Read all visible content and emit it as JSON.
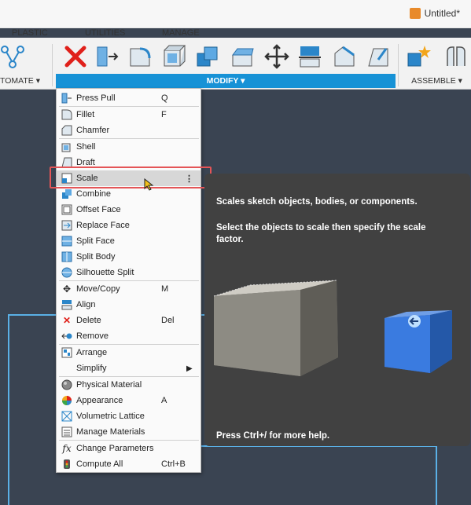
{
  "document": {
    "title": "Untitled*"
  },
  "tabs": [
    "PLASTIC",
    "UTILITIES",
    "MANAGE"
  ],
  "groups": {
    "automate": "TOMATE ▾",
    "modify": "MODIFY ▾",
    "assemble": "ASSEMBLE ▾"
  },
  "menu": {
    "items": [
      {
        "label": "Press Pull",
        "shortcut": "Q",
        "icon": "press-pull-icon"
      },
      {
        "label": "Fillet",
        "shortcut": "F",
        "icon": "fillet-icon"
      },
      {
        "label": "Chamfer",
        "shortcut": "",
        "icon": "chamfer-icon"
      },
      {
        "label": "Shell",
        "shortcut": "",
        "icon": "shell-icon"
      },
      {
        "label": "Draft",
        "shortcut": "",
        "icon": "draft-icon"
      },
      {
        "label": "Scale",
        "shortcut": "",
        "icon": "scale-icon"
      },
      {
        "label": "Combine",
        "shortcut": "",
        "icon": "combine-icon"
      },
      {
        "label": "Offset Face",
        "shortcut": "",
        "icon": "offset-face-icon"
      },
      {
        "label": "Replace Face",
        "shortcut": "",
        "icon": "replace-face-icon"
      },
      {
        "label": "Split Face",
        "shortcut": "",
        "icon": "split-face-icon"
      },
      {
        "label": "Split Body",
        "shortcut": "",
        "icon": "split-body-icon"
      },
      {
        "label": "Silhouette Split",
        "shortcut": "",
        "icon": "silhouette-split-icon"
      },
      {
        "label": "Move/Copy",
        "shortcut": "M",
        "icon": "move-icon"
      },
      {
        "label": "Align",
        "shortcut": "",
        "icon": "align-icon"
      },
      {
        "label": "Delete",
        "shortcut": "Del",
        "icon": "delete-icon"
      },
      {
        "label": "Remove",
        "shortcut": "",
        "icon": "remove-icon"
      },
      {
        "label": "Arrange",
        "shortcut": "",
        "icon": "arrange-icon"
      },
      {
        "label": "Simplify",
        "shortcut": "",
        "icon": "chevron-right-icon"
      },
      {
        "label": "Physical Material",
        "shortcut": "",
        "icon": "physical-material-icon"
      },
      {
        "label": "Appearance",
        "shortcut": "A",
        "icon": "appearance-icon"
      },
      {
        "label": "Volumetric Lattice",
        "shortcut": "",
        "icon": "lattice-icon"
      },
      {
        "label": "Manage Materials",
        "shortcut": "",
        "icon": "manage-materials-icon"
      },
      {
        "label": "Change Parameters",
        "shortcut": "",
        "icon": "fx-icon"
      },
      {
        "label": "Compute All",
        "shortcut": "Ctrl+B",
        "icon": "compute-all-icon"
      }
    ]
  },
  "tooltip": {
    "title": "Scales sketch objects, bodies, or components.",
    "body": "Select the objects to scale then specify the scale factor.",
    "help": "Press Ctrl+/ for more help."
  },
  "colors": {
    "accent": "#1792d6",
    "highlight": "#e45557",
    "tooltip_bg": "#414141"
  }
}
